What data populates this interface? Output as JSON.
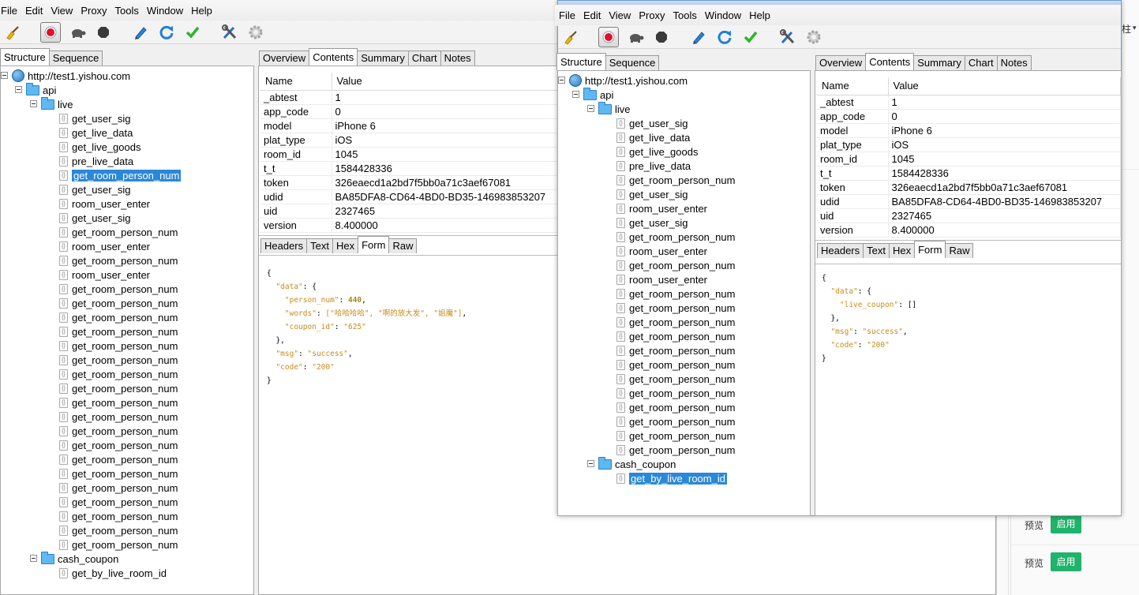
{
  "menus": [
    "File",
    "Edit",
    "View",
    "Proxy",
    "Tools",
    "Window",
    "Help"
  ],
  "toolbar_icons": [
    "broom-icon",
    "record-icon",
    "turtle-icon",
    "stop-hex-icon",
    "pen-icon",
    "refresh-icon",
    "check-icon",
    "tools-icon",
    "gear-icon"
  ],
  "left_tabs": [
    "Structure",
    "Sequence"
  ],
  "top_tabs": [
    "Overview",
    "Contents",
    "Summary",
    "Chart",
    "Notes"
  ],
  "bottom_tabs": [
    "Headers",
    "Text",
    "Hex",
    "Form",
    "Raw"
  ],
  "columns": {
    "name": "Name",
    "value": "Value"
  },
  "window1": {
    "host": "http://test1.yishou.com",
    "folder_api": "api",
    "folder_live": "live",
    "live_items": [
      "get_user_sig",
      "get_live_data",
      "get_live_goods",
      "pre_live_data",
      "get_room_person_num",
      "get_user_sig",
      "room_user_enter",
      "get_user_sig",
      "get_room_person_num",
      "room_user_enter",
      "get_room_person_num",
      "room_user_enter",
      "get_room_person_num",
      "get_room_person_num",
      "get_room_person_num",
      "get_room_person_num",
      "get_room_person_num",
      "get_room_person_num",
      "get_room_person_num",
      "get_room_person_num",
      "get_room_person_num",
      "get_room_person_num",
      "get_room_person_num",
      "get_room_person_num",
      "get_room_person_num",
      "get_room_person_num",
      "get_room_person_num",
      "get_room_person_num",
      "get_room_person_num",
      "get_room_person_num",
      "get_room_person_num"
    ],
    "folder_cash": "cash_coupon",
    "cash_items": [
      "get_by_live_room_id"
    ],
    "rows": [
      {
        "name": "_abtest",
        "value": "1"
      },
      {
        "name": "app_code",
        "value": "0"
      },
      {
        "name": "model",
        "value": "iPhone 6"
      },
      {
        "name": "plat_type",
        "value": "iOS"
      },
      {
        "name": "room_id",
        "value": "1045"
      },
      {
        "name": "t_t",
        "value": "1584428336"
      },
      {
        "name": "token",
        "value": "326eaecd1a2bd7f5bb0a71c3aef67081"
      },
      {
        "name": "udid",
        "value": "BA85DFA8-CD64-4BD0-BD35-146983853207"
      },
      {
        "name": "uid",
        "value": "2327465"
      },
      {
        "name": "version",
        "value": "8.400000"
      }
    ],
    "json": {
      "open": "{",
      "data_key": "\"data\"",
      "data_open": ": {",
      "person_num_key": "\"person_num\"",
      "person_num_val": "440",
      "words_key": "\"words\"",
      "words_val": "[\"哈哈哈哈\", \"啊的放大发\", \"姐魔\"]",
      "coupon_key": "\"coupon_id\"",
      "coupon_val": "\"625\"",
      "data_close": "},",
      "msg_key": "\"msg\"",
      "msg_val": "\"success\"",
      "code_key": "\"code\"",
      "code_val": "\"200\"",
      "close": "}"
    }
  },
  "window2": {
    "host": "http://test1.yishou.com",
    "folder_api": "api",
    "folder_live": "live",
    "live_items": [
      "get_user_sig",
      "get_live_data",
      "get_live_goods",
      "pre_live_data",
      "get_room_person_num",
      "get_user_sig",
      "room_user_enter",
      "get_user_sig",
      "get_room_person_num",
      "room_user_enter",
      "get_room_person_num",
      "room_user_enter",
      "get_room_person_num",
      "get_room_person_num",
      "get_room_person_num",
      "get_room_person_num",
      "get_room_person_num",
      "get_room_person_num",
      "get_room_person_num",
      "get_room_person_num",
      "get_room_person_num",
      "get_room_person_num",
      "get_room_person_num",
      "get_room_person_num"
    ],
    "folder_cash": "cash_coupon",
    "cash_items": [
      "get_by_live_room_id"
    ],
    "rows": [
      {
        "name": "_abtest",
        "value": "1"
      },
      {
        "name": "app_code",
        "value": "0"
      },
      {
        "name": "model",
        "value": "iPhone 6"
      },
      {
        "name": "plat_type",
        "value": "iOS"
      },
      {
        "name": "room_id",
        "value": "1045"
      },
      {
        "name": "t_t",
        "value": "1584428336"
      },
      {
        "name": "token",
        "value": "326eaecd1a2bd7f5bb0a71c3aef67081"
      },
      {
        "name": "udid",
        "value": "BA85DFA8-CD64-4BD0-BD35-146983853207"
      },
      {
        "name": "uid",
        "value": "2327465"
      },
      {
        "name": "version",
        "value": "8.400000"
      }
    ],
    "json": {
      "open": "{",
      "data_key": "\"data\"",
      "data_open": ": {",
      "coupon_key": "\"live_coupon\"",
      "coupon_val": "[]",
      "data_close": "},",
      "msg_key": "\"msg\"",
      "msg_val": "\"success\"",
      "code_key": "\"code\"",
      "code_val": "\"200\"",
      "close": "}"
    }
  },
  "background_page": {
    "corner_text": "柱",
    "preview_label": "预览",
    "enable_label": "启用"
  }
}
